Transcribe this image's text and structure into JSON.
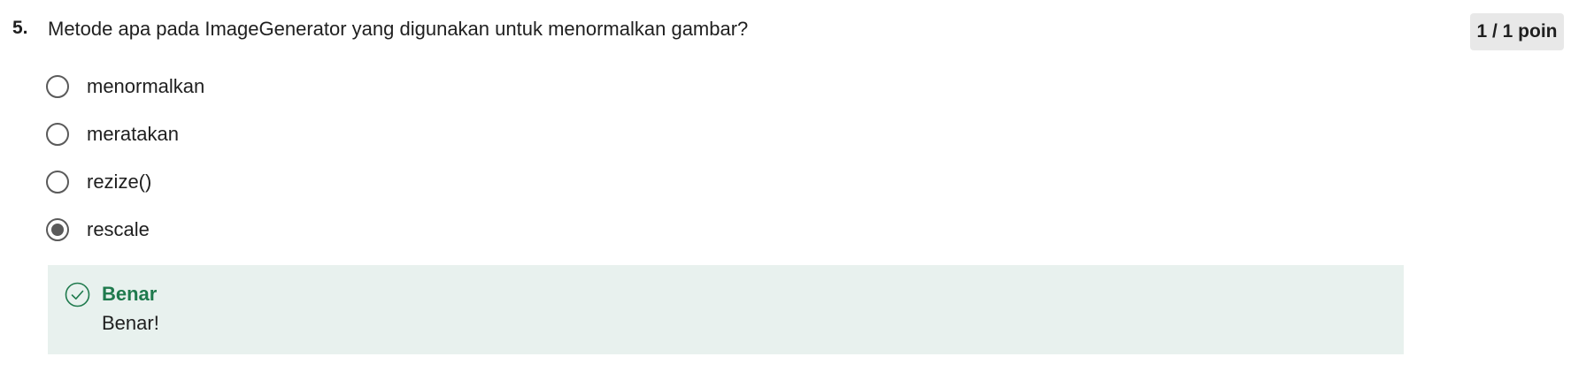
{
  "question": {
    "number": "5.",
    "text": "Metode apa pada ImageGenerator yang digunakan untuk menormalkan gambar?",
    "points": "1 / 1 poin"
  },
  "options": [
    {
      "label": "menormalkan",
      "selected": false
    },
    {
      "label": "meratakan",
      "selected": false
    },
    {
      "label": "rezize()",
      "selected": false
    },
    {
      "label": "rescale",
      "selected": true
    }
  ],
  "feedback": {
    "title": "Benar",
    "message": "Benar!",
    "icon": "check-circle-icon",
    "accent_color": "#1f7a4d",
    "background_color": "#e8f1ee"
  },
  "colors": {
    "radio_border": "#5a5a5a",
    "badge_background": "#e8e8e8"
  }
}
